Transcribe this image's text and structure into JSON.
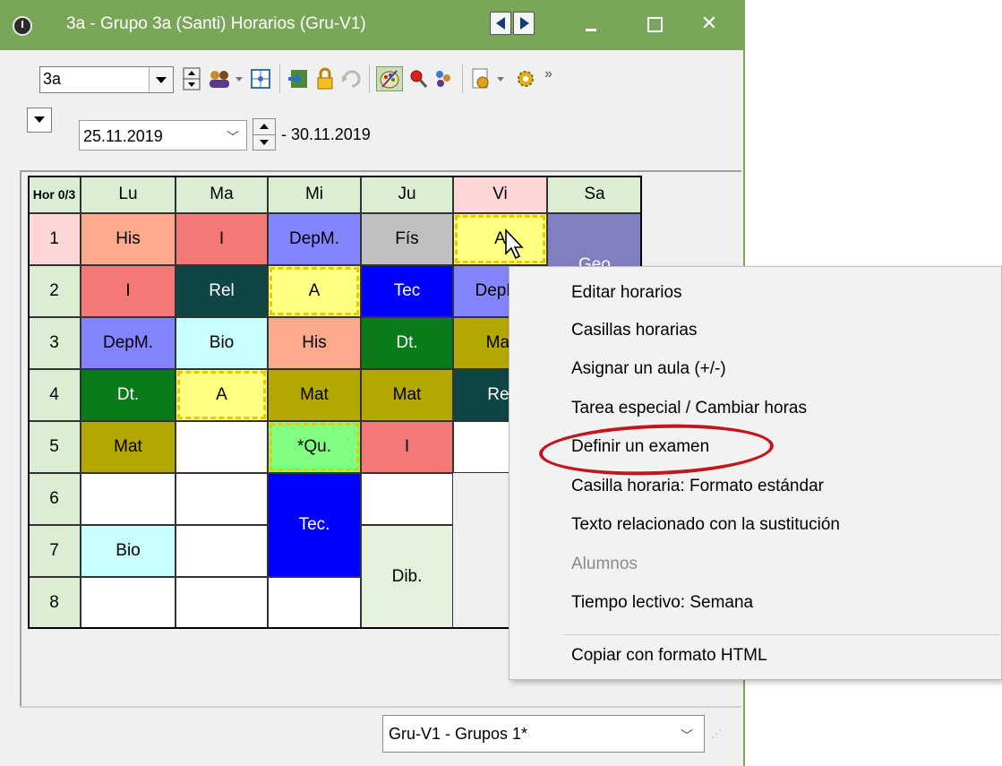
{
  "window": {
    "title": "3a - Grupo 3a (Santi)  Horarios  (Gru-V1)"
  },
  "toolbar": {
    "class_value": "3a",
    "overflow_label": "»"
  },
  "datebar": {
    "start_date": "25.11.2019",
    "end_date": "- 30.11.2019"
  },
  "timetable": {
    "corner": "Hor 0/3",
    "days": [
      {
        "label": "Lu",
        "bg": "#dbeed3"
      },
      {
        "label": "Ma",
        "bg": "#dbeed3"
      },
      {
        "label": "Mi",
        "bg": "#dbeed3"
      },
      {
        "label": "Ju",
        "bg": "#dbeed3"
      },
      {
        "label": "Vi",
        "bg": "#ffd6d8"
      },
      {
        "label": "Sa",
        "bg": "#dbeed3"
      }
    ],
    "periods": [
      {
        "label": "1",
        "bg": "#ffd6d8"
      },
      {
        "label": "2",
        "bg": "#dbeed3"
      },
      {
        "label": "3",
        "bg": "#dbeed3"
      },
      {
        "label": "4",
        "bg": "#dbeed3"
      },
      {
        "label": "5",
        "bg": "#dbeed3"
      },
      {
        "label": "6",
        "bg": "#dbeed3"
      },
      {
        "label": "7",
        "bg": "#dbeed3"
      },
      {
        "label": "8",
        "bg": "#dbeed3"
      }
    ],
    "lessons": [
      {
        "day": 0,
        "period": 0,
        "span": 1,
        "text": "His",
        "bg": "#fca98e",
        "color": "#000000"
      },
      {
        "day": 1,
        "period": 0,
        "span": 1,
        "text": "I",
        "bg": "#f47878",
        "color": "#000000"
      },
      {
        "day": 2,
        "period": 0,
        "span": 1,
        "text": "DepM.",
        "bg": "#8484ff",
        "color": "#000000"
      },
      {
        "day": 3,
        "period": 0,
        "span": 1,
        "text": "Fís",
        "bg": "#c0c0c0",
        "color": "#000000"
      },
      {
        "day": 4,
        "period": 0,
        "span": 1,
        "text": "A",
        "bg": "#ffff80",
        "color": "#000000",
        "dashed": true
      },
      {
        "day": 5,
        "period": 0,
        "span": 2,
        "text": "Geo",
        "bg": "#8080c0",
        "color": "#ffffff"
      },
      {
        "day": 0,
        "period": 1,
        "span": 1,
        "text": "I",
        "bg": "#f47878",
        "color": "#000000"
      },
      {
        "day": 1,
        "period": 1,
        "span": 1,
        "text": "Rel",
        "bg": "#0f4545",
        "color": "#ffffff"
      },
      {
        "day": 2,
        "period": 1,
        "span": 1,
        "text": "A",
        "bg": "#ffff80",
        "color": "#000000",
        "dashed": true
      },
      {
        "day": 3,
        "period": 1,
        "span": 1,
        "text": "Tec",
        "bg": "#0000ff",
        "color": "#ffffff"
      },
      {
        "day": 4,
        "period": 1,
        "span": 1,
        "text": "DepM.",
        "bg": "#8484ff",
        "color": "#000000"
      },
      {
        "day": 0,
        "period": 2,
        "span": 1,
        "text": "DepM.",
        "bg": "#8484ff",
        "color": "#000000"
      },
      {
        "day": 1,
        "period": 2,
        "span": 1,
        "text": "Bio",
        "bg": "#c8ffff",
        "color": "#000000"
      },
      {
        "day": 2,
        "period": 2,
        "span": 1,
        "text": "His",
        "bg": "#fca98e",
        "color": "#000000"
      },
      {
        "day": 3,
        "period": 2,
        "span": 1,
        "text": "Dt.",
        "bg": "#0a7a1a",
        "color": "#ffffff"
      },
      {
        "day": 4,
        "period": 2,
        "span": 1,
        "text": "Mat",
        "bg": "#b4a800",
        "color": "#000000"
      },
      {
        "day": 0,
        "period": 3,
        "span": 1,
        "text": "Dt.",
        "bg": "#0a7a1a",
        "color": "#ffffff"
      },
      {
        "day": 1,
        "period": 3,
        "span": 1,
        "text": "A",
        "bg": "#ffff80",
        "color": "#000000",
        "dashed": true
      },
      {
        "day": 2,
        "period": 3,
        "span": 1,
        "text": "Mat",
        "bg": "#b4a800",
        "color": "#000000"
      },
      {
        "day": 3,
        "period": 3,
        "span": 1,
        "text": "Mat",
        "bg": "#b4a800",
        "color": "#000000"
      },
      {
        "day": 4,
        "period": 3,
        "span": 1,
        "text": "Rel",
        "bg": "#0f4545",
        "color": "#ffffff"
      },
      {
        "day": 0,
        "period": 4,
        "span": 1,
        "text": "Mat",
        "bg": "#b4a800",
        "color": "#000000"
      },
      {
        "day": 1,
        "period": 4,
        "span": 1,
        "text": "",
        "bg": "#ffffff",
        "color": "#000000"
      },
      {
        "day": 2,
        "period": 4,
        "span": 1,
        "text": "*Qu.",
        "bg": "#80ff80",
        "color": "#000000",
        "dashed": true
      },
      {
        "day": 3,
        "period": 4,
        "span": 1,
        "text": "I",
        "bg": "#f47878",
        "color": "#000000"
      },
      {
        "day": 4,
        "period": 4,
        "span": 1,
        "text": "",
        "bg": "#ffffff",
        "color": "#000000"
      },
      {
        "day": 0,
        "period": 5,
        "span": 1,
        "text": "",
        "bg": "#ffffff",
        "color": "#000000"
      },
      {
        "day": 1,
        "period": 5,
        "span": 1,
        "text": "",
        "bg": "#ffffff",
        "color": "#000000"
      },
      {
        "day": 2,
        "period": 5,
        "span": 2,
        "text": "Tec.",
        "bg": "#0000ff",
        "color": "#ffffff"
      },
      {
        "day": 3,
        "period": 5,
        "span": 1,
        "text": "",
        "bg": "#ffffff",
        "color": "#000000"
      },
      {
        "day": 0,
        "period": 6,
        "span": 1,
        "text": "Bio",
        "bg": "#c8ffff",
        "color": "#000000"
      },
      {
        "day": 1,
        "period": 6,
        "span": 1,
        "text": "",
        "bg": "#ffffff",
        "color": "#000000"
      },
      {
        "day": 3,
        "period": 6,
        "span": 2,
        "text": "Dib.",
        "bg": "#e4f2dc",
        "color": "#000000"
      },
      {
        "day": 0,
        "period": 7,
        "span": 1,
        "text": "",
        "bg": "#ffffff",
        "color": "#000000"
      },
      {
        "day": 1,
        "period": 7,
        "span": 1,
        "text": "",
        "bg": "#ffffff",
        "color": "#000000"
      },
      {
        "day": 2,
        "period": 7,
        "span": 1,
        "text": "",
        "bg": "#ffffff",
        "color": "#000000"
      }
    ]
  },
  "format_selector": {
    "value": "Gru-V1 - Grupos 1*"
  },
  "context_menu": {
    "items": [
      {
        "label": "Editar horarios",
        "enabled": true
      },
      {
        "label": "Casillas horarias",
        "enabled": true
      },
      {
        "label": "Asignar un aula (+/-)",
        "enabled": true
      },
      {
        "label": "Tarea especial / Cambiar horas",
        "enabled": true
      },
      {
        "label": "Definir un examen",
        "enabled": true,
        "highlighted": true
      },
      {
        "label": "Casilla horaria: Formato estándar",
        "enabled": true
      },
      {
        "label": "Texto relacionado con la sustitución",
        "enabled": true
      },
      {
        "label": "Alumnos",
        "enabled": false
      },
      {
        "label": "Tiempo lectivo: Semana",
        "enabled": true
      },
      {
        "label": "Copiar con formato HTML",
        "enabled": true
      }
    ],
    "highlight_color": "#c0161c"
  },
  "icons": [
    "clock-icon",
    "nav-prev-icon",
    "nav-next-icon",
    "minimize-icon",
    "maximize-icon",
    "close-icon",
    "spin-icon",
    "teachers-icon",
    "grid-icon",
    "export-icon",
    "lock-icon",
    "undo-icon",
    "palette-icon",
    "search-icon",
    "people-icon",
    "settings-doc-icon",
    "gear-icon",
    "mouse-cursor-icon"
  ]
}
